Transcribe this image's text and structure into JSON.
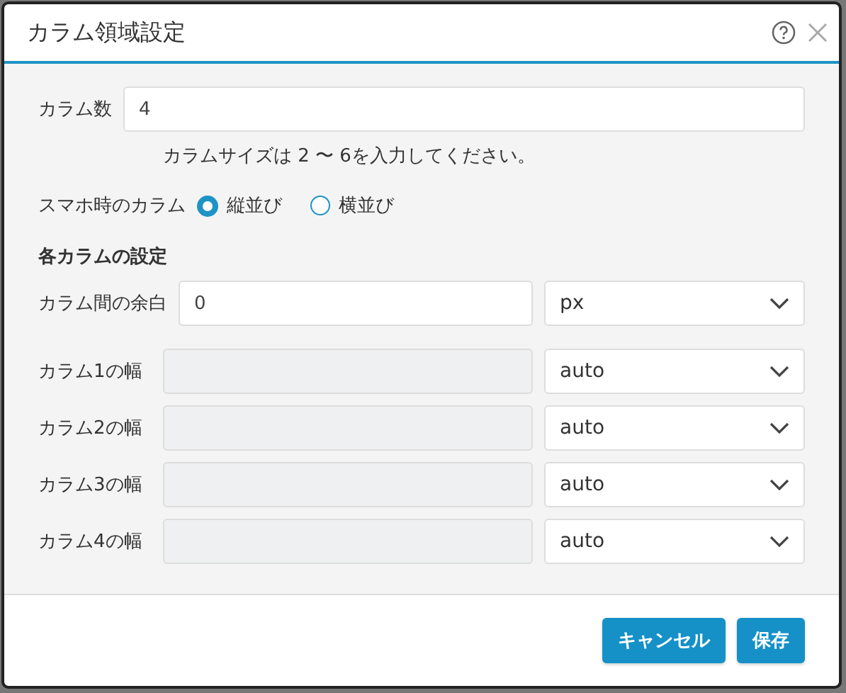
{
  "window": {
    "title": "カラム領域設定"
  },
  "column_count": {
    "label": "カラム数",
    "value": "4",
    "hint": "カラムサイズは 2 〜 6を入力してください。"
  },
  "mobile_layout": {
    "label": "スマホ時のカラム",
    "options": [
      {
        "label": "縦並び",
        "selected": true
      },
      {
        "label": "横並び",
        "selected": false
      }
    ]
  },
  "section_title": "各カラムの設定",
  "gap": {
    "label": "カラム間の余白",
    "value": "0",
    "unit": "px"
  },
  "widths": [
    {
      "label": "カラム1の幅",
      "disabled": true,
      "unit": "auto"
    },
    {
      "label": "カラム2の幅",
      "disabled": true,
      "unit": "auto"
    },
    {
      "label": "カラム3の幅",
      "disabled": true,
      "unit": "auto"
    },
    {
      "label": "カラム4の幅",
      "disabled": true,
      "unit": "auto"
    }
  ],
  "buttons": [
    {
      "label": "キャンセル"
    },
    {
      "label": "保存"
    }
  ]
}
